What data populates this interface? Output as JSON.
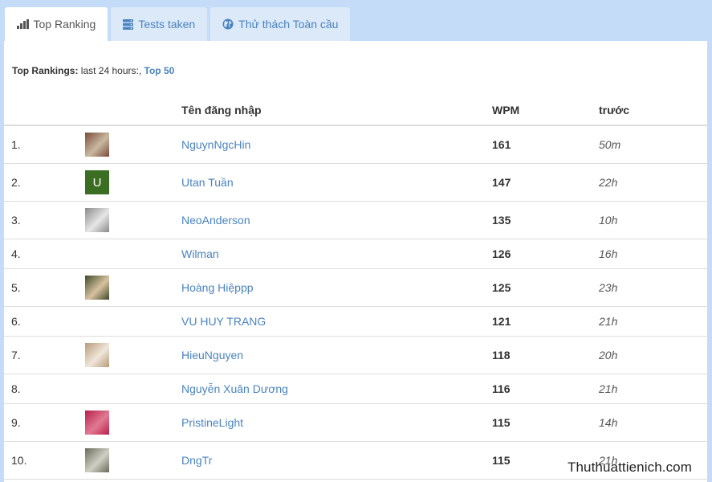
{
  "tabs": [
    {
      "label": "Top Ranking",
      "icon": "bar-chart-icon",
      "active": true
    },
    {
      "label": "Tests taken",
      "icon": "server-icon",
      "active": false
    },
    {
      "label": "Thử thách Toàn cầu",
      "icon": "globe-icon",
      "active": false
    }
  ],
  "summary": {
    "label": "Top Rankings:",
    "period": "last 24 hours:,",
    "link": "Top 50"
  },
  "table": {
    "headers": {
      "rank": "",
      "avatar": "",
      "username": "Tên đăng nhập",
      "wpm": "WPM",
      "ago": "trước"
    },
    "rows": [
      {
        "rank": "1.",
        "username": "NguynNgcHin",
        "wpm": "161",
        "ago": "50m",
        "avatar": "photo",
        "avatar_colors": [
          "#7a4a3a",
          "#c9b9a0"
        ]
      },
      {
        "rank": "2.",
        "username": "Utan Tuần",
        "wpm": "147",
        "ago": "22h",
        "avatar": "letter",
        "avatar_letter": "U"
      },
      {
        "rank": "3.",
        "username": "NeoAnderson",
        "wpm": "135",
        "ago": "10h",
        "avatar": "photo",
        "avatar_colors": [
          "#8a8a8a",
          "#e6e6e6"
        ]
      },
      {
        "rank": "4.",
        "username": "Wilman",
        "wpm": "126",
        "ago": "16h",
        "avatar": "none"
      },
      {
        "rank": "5.",
        "username": "Hoàng Hiệppp",
        "wpm": "125",
        "ago": "23h",
        "avatar": "photo",
        "avatar_colors": [
          "#3d4a2a",
          "#d8c2a0"
        ]
      },
      {
        "rank": "6.",
        "username": "VU HUY TRANG",
        "wpm": "121",
        "ago": "21h",
        "avatar": "none"
      },
      {
        "rank": "7.",
        "username": "HieuNguyen",
        "wpm": "118",
        "ago": "20h",
        "avatar": "photo",
        "avatar_colors": [
          "#b89a7a",
          "#efe6da"
        ]
      },
      {
        "rank": "8.",
        "username": "Nguyễn Xuân Dương",
        "wpm": "116",
        "ago": "21h",
        "avatar": "none"
      },
      {
        "rank": "9.",
        "username": "PristineLight",
        "wpm": "115",
        "ago": "14h",
        "avatar": "photo",
        "avatar_colors": [
          "#b8204a",
          "#e07a92"
        ]
      },
      {
        "rank": "10.",
        "username": "DngTr",
        "wpm": "115",
        "ago": "21h",
        "avatar": "photo",
        "avatar_colors": [
          "#6a6a5a",
          "#cfcfc4"
        ]
      }
    ]
  },
  "watermark": "Thuthuattienich.com",
  "colors": {
    "link": "#4a83be",
    "background": "#c4dcf8",
    "tab_inactive": "#dbe9f8"
  }
}
